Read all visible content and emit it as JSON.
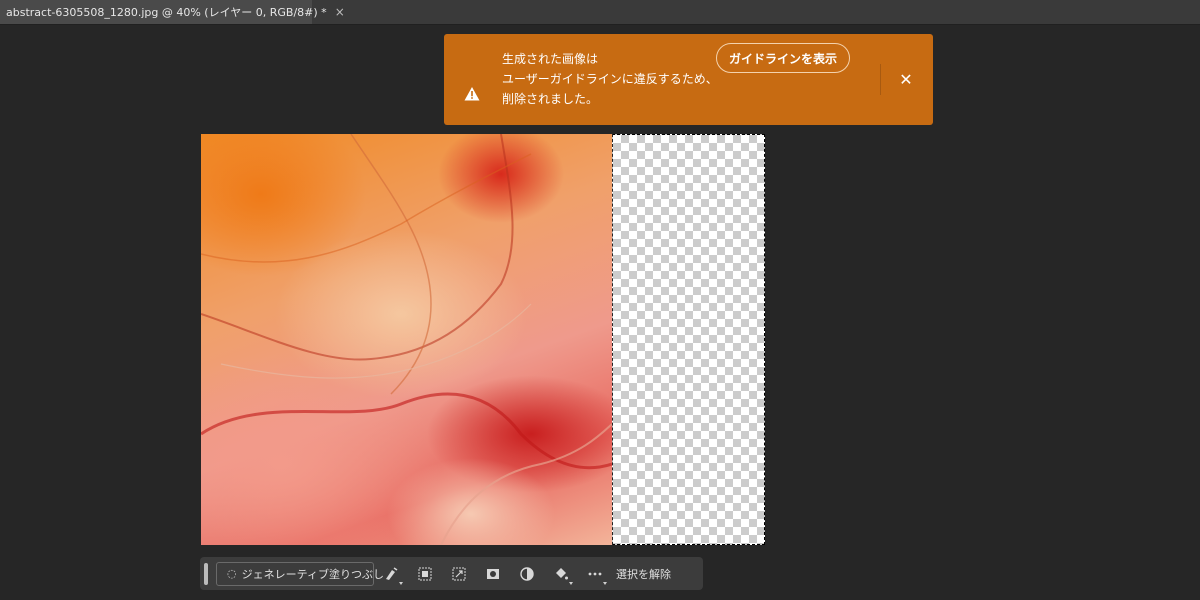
{
  "document_tab": {
    "title": "abstract-6305508_1280.jpg @ 40% (レイヤー 0, RGB/8#) *",
    "close_glyph": "×"
  },
  "toast": {
    "background": "#c76b12",
    "icon": "warning-triangle-icon",
    "message_lines": [
      "生成された画像は",
      "ユーザーガイドラインに違反するため、",
      "削除されました。"
    ],
    "guideline_button_label": "ガイドラインを表示",
    "close_glyph": "✕"
  },
  "taskbar": {
    "generative_fill_label": "ジェネレーティブ塗りつぶし",
    "generative_fill_icon": "sparkle-icon",
    "tools": [
      {
        "name": "modify-selection-icon",
        "has_caret": true
      },
      {
        "name": "select-inverse-icon",
        "has_caret": false
      },
      {
        "name": "transform-selection-icon",
        "has_caret": false
      },
      {
        "name": "create-mask-icon",
        "has_caret": false
      },
      {
        "name": "adjustment-layer-icon",
        "has_caret": false
      },
      {
        "name": "fill-selection-icon",
        "has_caret": true
      },
      {
        "name": "more-options-icon",
        "has_caret": true
      }
    ],
    "deselect_label": "選択を解除"
  }
}
